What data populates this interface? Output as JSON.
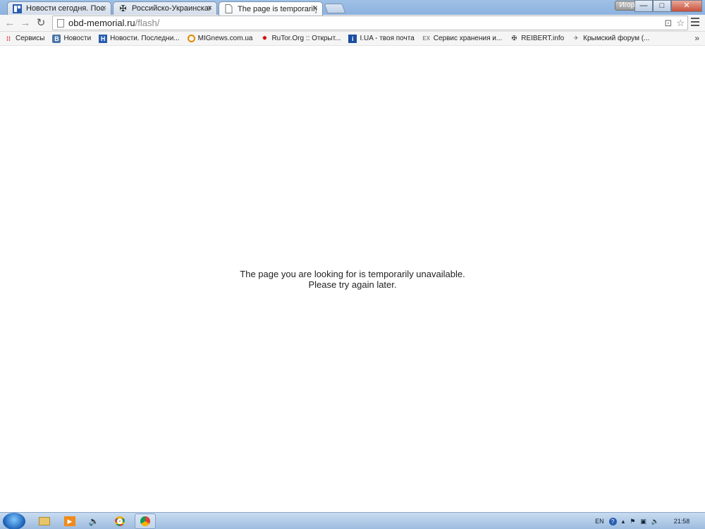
{
  "tabs": [
    {
      "title": "Новости сегодня. После",
      "favicon": "news-icon",
      "active": false
    },
    {
      "title": "Российско-Украинская в",
      "favicon": "cross-icon",
      "active": false
    },
    {
      "title": "The page is temporarily u",
      "favicon": "page-icon",
      "active": true
    }
  ],
  "window": {
    "user": "Игорь",
    "minimize": "—",
    "maximize": "□",
    "close": "✕"
  },
  "address": {
    "host": "obd-memorial.ru",
    "path": "/flash/"
  },
  "bookmarks": [
    {
      "label": "Сервисы",
      "icon": "apps-icon"
    },
    {
      "label": "Новости",
      "icon": "vk-icon"
    },
    {
      "label": "Новости. Последни...",
      "icon": "news-icon"
    },
    {
      "label": "MIGnews.com.ua",
      "icon": "mig-icon"
    },
    {
      "label": "RuTor.Org :: Открыт...",
      "icon": "rutor-icon"
    },
    {
      "label": "I.UA - твоя почта",
      "icon": "iua-icon"
    },
    {
      "label": "Сервис хранения и...",
      "icon": "ex-icon"
    },
    {
      "label": "REIBERT.info",
      "icon": "cross-icon"
    },
    {
      "label": "Крымский форум (...",
      "icon": "plane-icon"
    }
  ],
  "bookmarks_more": "»",
  "message": {
    "line1": "The page you are looking for is temporarily unavailable.",
    "line2": "Please try again later."
  },
  "taskbar": {
    "language": "EN",
    "clock": "21:58"
  }
}
